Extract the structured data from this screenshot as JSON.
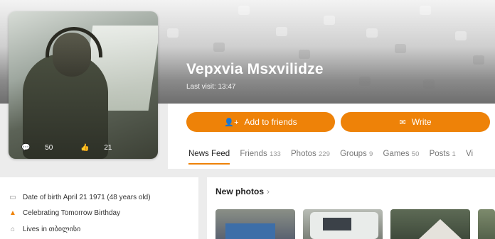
{
  "profile": {
    "name": "Vepxvia Msxvilidze",
    "last_visit": "Last visit: 13:47",
    "photo_comments": "50",
    "photo_likes": "21"
  },
  "actions": {
    "add_friends": "Add to friends",
    "write": "Write"
  },
  "tabs": [
    {
      "label": "News Feed",
      "count": ""
    },
    {
      "label": "Friends",
      "count": "133"
    },
    {
      "label": "Photos",
      "count": "229"
    },
    {
      "label": "Groups",
      "count": "9"
    },
    {
      "label": "Games",
      "count": "50"
    },
    {
      "label": "Posts",
      "count": "1"
    },
    {
      "label": "Vi",
      "count": ""
    }
  ],
  "info": {
    "birth": "Date of birth April 21 1971 (48 years old)",
    "birthday": "Celebrating Tomorrow Birthday",
    "lives": "Lives in თბილისი"
  },
  "new_photos": {
    "title": "New photos",
    "chevron": "›"
  },
  "colors": {
    "accent": "#ee8208"
  }
}
